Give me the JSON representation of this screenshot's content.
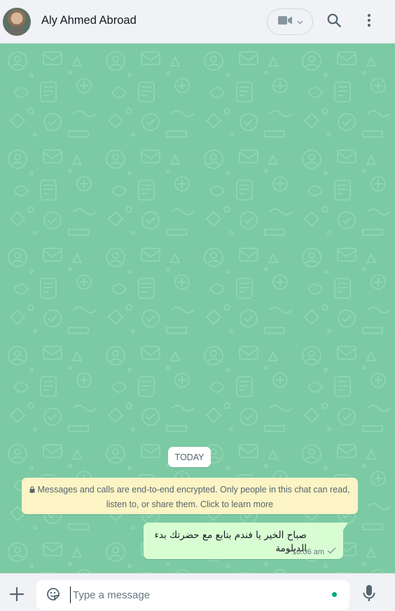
{
  "header": {
    "contact_name": "Aly Ahmed Abroad",
    "icons": [
      "avatar",
      "video-call-icon",
      "chevron-down-icon",
      "search-icon",
      "menu-icon"
    ]
  },
  "chat": {
    "date_chip": "TODAY",
    "encryption_notice": "Messages and calls are end-to-end encrypted. Only people in this chat can read, listen to, or share them. Click to learn more",
    "messages": [
      {
        "direction": "outgoing",
        "text": "صباح الخير يا فندم بتابع مع حضرتك بدء الدبلومة",
        "time": "10:06 am",
        "status": "sent"
      }
    ]
  },
  "footer": {
    "placeholder": "Type a message",
    "value": "",
    "icons": [
      "plus-icon",
      "sticker-icon",
      "mic-icon"
    ]
  },
  "colors": {
    "chat_background": "#7bcaa4",
    "outgoing_bubble": "#d9fdd3",
    "notice_background": "#fdf4c5",
    "accent": "#00a884"
  }
}
